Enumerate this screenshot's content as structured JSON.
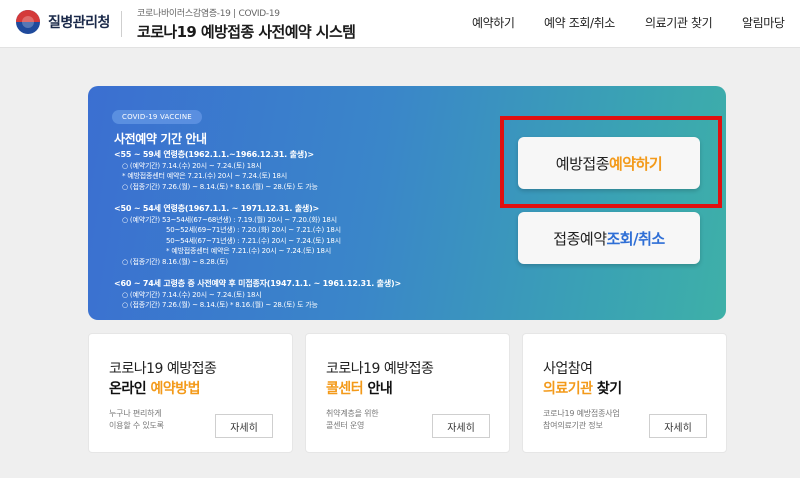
{
  "header": {
    "org_name": "질병관리청",
    "subtitle": "코로나바이러스감염증-19 | COVID-19",
    "title": "코로나19 예방접종 사전예약 시스템",
    "nav": [
      "예약하기",
      "예약 조회/취소",
      "의료기관 찾기",
      "알림마당"
    ]
  },
  "banner": {
    "tag": "COVID-19 VACCINE",
    "title": "사전예약 기간 안내",
    "groups": [
      {
        "head": "<55 ~ 59세 연령층(1962.1.1.~1966.12.31. 출생)>",
        "lines": [
          "○ (예약기간) 7.14.(수) 20시 ~ 7.24.(토) 18시",
          "* 예방접종센터 예약은 7.21.(수) 20시 ~ 7.24.(토) 18시",
          "○ (접종기간) 7.26.(월) ~ 8.14.(토)     * 8.16.(월) ~ 28.(토) 도 가능"
        ]
      },
      {
        "head": "<50 ~ 54세 연령층(1967.1.1. ~ 1971.12.31. 출생)>",
        "lines": [
          "○ (예약기간) 53~54세(67~68년생) : 7.19.(월) 20시 ~ 7.20.(화) 18시",
          "50~52세(69~71년생) : 7.20.(화) 20시 ~ 7.21.(수) 18시",
          "50~54세(67~71년생) : 7.21.(수) 20시 ~ 7.24.(토) 18시",
          "* 예방접종센터 예약은 7.21.(수) 20시 ~ 7.24.(토) 18시",
          "○ (접종기간) 8.16.(월) ~ 8.28.(토)"
        ]
      },
      {
        "head": "<60 ~ 74세 고령층 중 사전예약 후 미접종자(1947.1.1. ~ 1961.12.31. 출생)>",
        "lines": [
          "○ (예약기간) 7.14.(수) 20시 ~ 7.24.(토) 18시",
          "○ (접종기간) 7.26.(월) ~ 8.14.(토)     * 8.16.(월) ~ 28.(토) 도 가능"
        ]
      }
    ],
    "cta_reserve": {
      "pre": "예방접종 ",
      "accent": "예약하기"
    },
    "cta_lookup": {
      "pre": "접종예약 ",
      "accent": "조회/취소"
    }
  },
  "cards": [
    {
      "line1": "코로나19 예방접종",
      "line2_accent": "예약방법",
      "line2_pre": "온라인 ",
      "line2_post": "",
      "desc1": "누구나 편리하게",
      "desc2": "이용할 수 있도록",
      "button": "자세히"
    },
    {
      "line1": "코로나19 예방접종",
      "line2_accent": "콜센터",
      "line2_pre": "",
      "line2_post": " 안내",
      "desc1": "취약계층을 위한",
      "desc2": "콜센터 운영",
      "button": "자세히"
    },
    {
      "line1": "사업참여",
      "line2_accent": "의료기관",
      "line2_pre": "",
      "line2_post": " 찾기",
      "desc1": "코로나19 예방접종사업",
      "desc2": "참여의료기관 정보",
      "button": "자세히"
    }
  ],
  "colors": {
    "accent_orange": "#f39a1a",
    "accent_blue": "#2f6fd6",
    "highlight_red": "#e01010"
  },
  "icons": {
    "logo": "kdca-emblem-icon"
  }
}
